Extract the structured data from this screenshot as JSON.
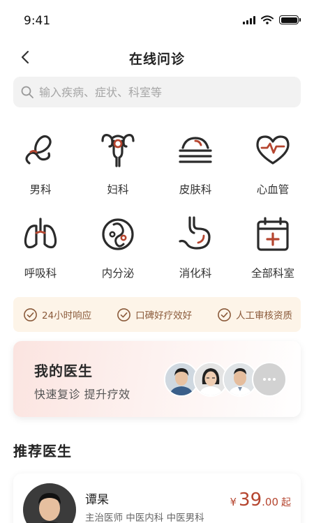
{
  "status_bar": {
    "time": "9:41"
  },
  "nav": {
    "title": "在线问诊"
  },
  "search": {
    "placeholder": "输入疾病、症状、科室等"
  },
  "categories": [
    {
      "label": "男科",
      "icon": "male-health-icon"
    },
    {
      "label": "妇科",
      "icon": "uterus-icon"
    },
    {
      "label": "皮肤科",
      "icon": "skin-icon"
    },
    {
      "label": "心血管",
      "icon": "heart-pulse-icon"
    },
    {
      "label": "呼吸科",
      "icon": "lungs-icon"
    },
    {
      "label": "内分泌",
      "icon": "endocrine-icon"
    },
    {
      "label": "消化科",
      "icon": "stomach-icon"
    },
    {
      "label": "全部科室",
      "icon": "hospital-calendar-icon"
    }
  ],
  "features": [
    {
      "label": "24小时响应"
    },
    {
      "label": "口碑好疗效好"
    },
    {
      "label": "人工审核资质"
    }
  ],
  "my_doctors": {
    "title": "我的医生",
    "subtitle": "快速复诊 提升疗效"
  },
  "recommended": {
    "title": "推荐医生",
    "doctor": {
      "name": "谭杲",
      "title_line": "主治医师  中医内科  中医男科",
      "currency": "¥",
      "price_int": "39",
      "price_dec": ".00",
      "price_suffix": "起"
    }
  },
  "colors": {
    "accent": "#b5452f",
    "icon_line": "#2b2b2b",
    "feature_bg": "#fdf4e8",
    "feature_text": "#8a5a3a"
  }
}
